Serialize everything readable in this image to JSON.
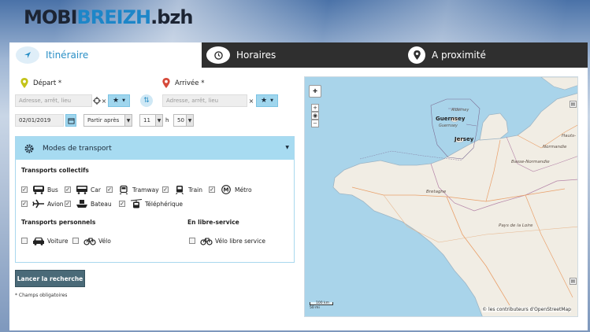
{
  "logo": {
    "part1": "MOBI",
    "part2": "BREIZH",
    "part3": ".bzh"
  },
  "tabs": [
    {
      "label": "Itinéraire",
      "icon": "send-icon"
    },
    {
      "label": "Horaires",
      "icon": "clock-icon"
    },
    {
      "label": "A proximité",
      "icon": "map-pin-icon"
    }
  ],
  "form": {
    "depart_label": "Départ *",
    "arrivee_label": "Arrivée *",
    "depart_placeholder": "Adresse, arrêt, lieu",
    "arrivee_placeholder": "Adresse, arrêt, lieu",
    "date_value": "02/01/2019",
    "time_mode": "Partir après",
    "hour": "11",
    "hour_sep": "h",
    "minute": "50",
    "clear": "×",
    "colors": {
      "depart_pin": "#c3c319",
      "arrivee_pin": "#d64a3a"
    }
  },
  "modes": {
    "title": "Modes de transport",
    "collectifs_title": "Transports collectifs",
    "collectifs": [
      {
        "label": "Bus",
        "checked": true
      },
      {
        "label": "Car",
        "checked": true
      },
      {
        "label": "Tramway",
        "checked": true
      },
      {
        "label": "Train",
        "checked": true
      },
      {
        "label": "Métro",
        "checked": true
      },
      {
        "label": "Avion",
        "checked": true
      },
      {
        "label": "Bateau",
        "checked": true
      },
      {
        "label": "Téléphérique",
        "checked": true
      }
    ],
    "personnels_title": "Transports personnels",
    "personnels": [
      {
        "label": "Voiture",
        "checked": false
      },
      {
        "label": "Vélo",
        "checked": false
      }
    ],
    "libre_title": "En libre-service",
    "libre": [
      {
        "label": "Vélo libre service",
        "checked": false
      }
    ]
  },
  "search_button": "Lancer la recherche",
  "required_note": "* Champs obligatoires",
  "map": {
    "zoom_in": "+",
    "zoom_out": "−",
    "labels": {
      "alderney": "Alderney",
      "guernsey": "Guernsey",
      "guernsey_small": "Guernsey",
      "jersey": "Jersey",
      "hauts": "Hauts-",
      "normandie": "Normandie",
      "basse_normandie": "Basse-Normandie",
      "bretagne": "Bretagne",
      "pays_de_la_loire": "Pays de la Loire"
    },
    "scale_km": "100 km",
    "scale_mi": "50 mi",
    "attribution": "© les contributeurs d'OpenStreetMap"
  }
}
